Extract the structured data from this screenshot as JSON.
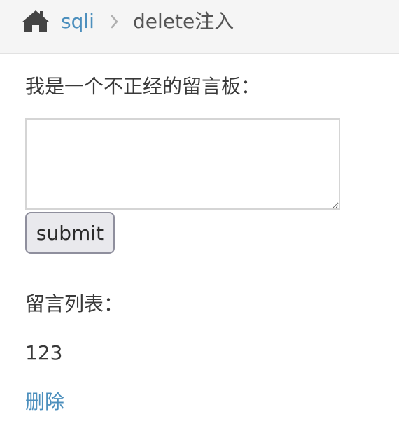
{
  "breadcrumb": {
    "home_icon": "home-icon",
    "link_label": "sqli",
    "separator_icon": "chevron-right-icon",
    "active_label": "delete注入"
  },
  "form": {
    "title": "我是一个不正经的留言板：",
    "textarea_value": "",
    "submit_label": "submit"
  },
  "messages": {
    "title": "留言列表：",
    "items": [
      {
        "text": "123",
        "delete_label": "删除"
      }
    ]
  },
  "colors": {
    "link": "#4c8fbd",
    "text": "#393939",
    "breadcrumb_bg": "#f5f5f5"
  }
}
